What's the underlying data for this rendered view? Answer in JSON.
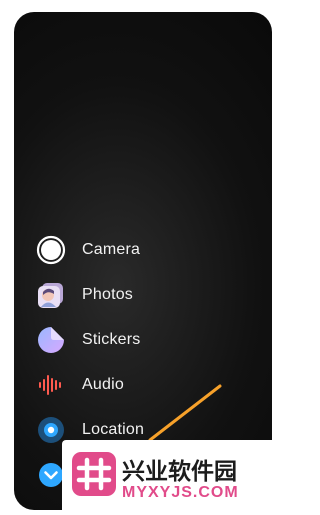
{
  "menu": {
    "items": [
      {
        "label": "Camera",
        "icon": "camera-shutter-icon"
      },
      {
        "label": "Photos",
        "icon": "photos-icon"
      },
      {
        "label": "Stickers",
        "icon": "stickers-icon"
      },
      {
        "label": "Audio",
        "icon": "audio-waveform-icon"
      },
      {
        "label": "Location",
        "icon": "location-icon"
      },
      {
        "label": "",
        "icon": "chevron-down-icon"
      }
    ]
  },
  "watermark": {
    "title": "兴业软件园",
    "url": "MYXYJS.COM"
  },
  "colors": {
    "background": "#0b0b0b",
    "swipe": "#f7a12a",
    "location_blue": "#2ea7ff",
    "watermark_pink": "#e14b8a"
  }
}
